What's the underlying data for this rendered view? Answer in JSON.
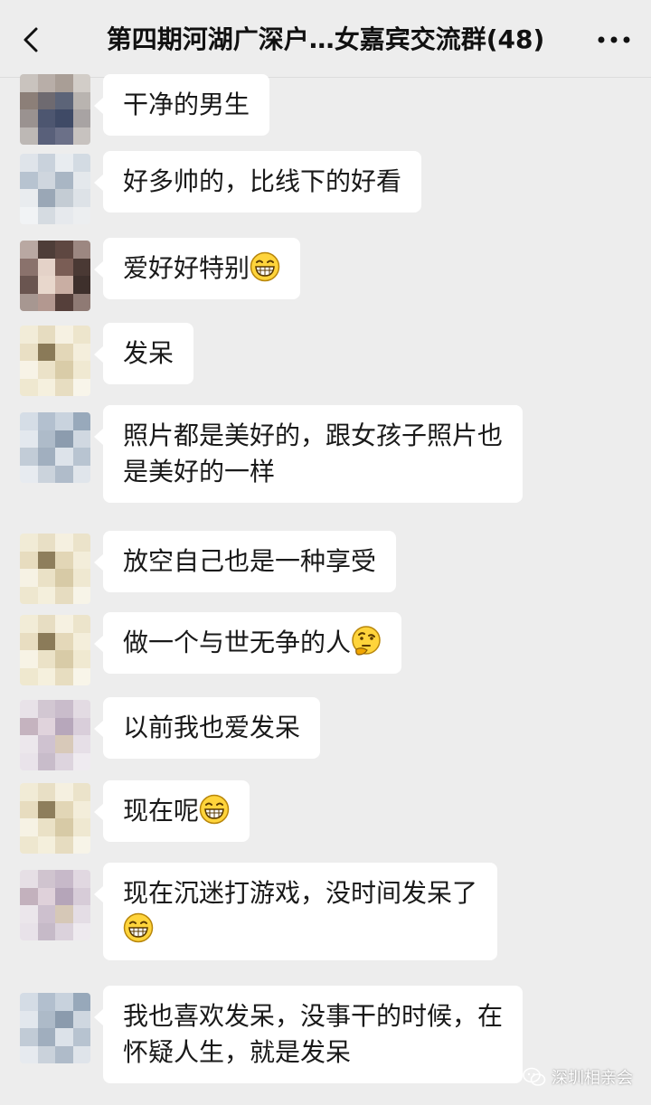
{
  "header": {
    "title": "第四期河湖广深户…女嘉宾交流群(48)",
    "back_icon": "chevron-left-icon",
    "more_icon": "more-dots-icon"
  },
  "messages": [
    {
      "text": "干净的男生"
    },
    {
      "text": "好多帅的，比线下的好看"
    },
    {
      "text": "爱好好特别",
      "emoji": "grin"
    },
    {
      "text": "发呆"
    },
    {
      "line1": "照片都是美好的，跟女孩子照片也",
      "line2": "是美好的一样"
    },
    {
      "text": "放空自己也是一种享受"
    },
    {
      "text": "做一个与世无争的人",
      "emoji": "thinking"
    },
    {
      "text": "以前我也爱发呆"
    },
    {
      "text": "现在呢",
      "emoji": "grin"
    },
    {
      "line1": "现在沉迷打游戏，没时间发呆了",
      "line2": "",
      "emoji": "grin"
    },
    {
      "line1": "我也喜欢发呆，没事干的时候，在",
      "line2": "怀疑人生，就是发呆"
    }
  ],
  "watermark": {
    "text": "深圳相亲会"
  },
  "colors": {
    "background": "#ededed",
    "bubble": "#ffffff",
    "text": "#191919"
  }
}
